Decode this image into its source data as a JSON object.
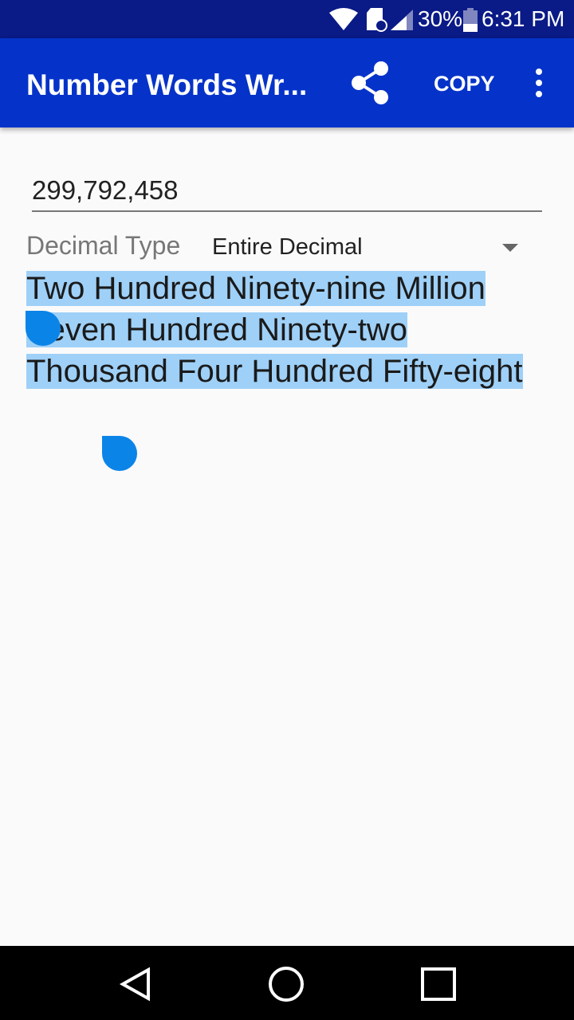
{
  "status_bar": {
    "battery": "30%",
    "time": "6:31 PM",
    "icons": [
      "wifi-icon",
      "sd-card-error-icon",
      "signal-icon",
      "battery-icon"
    ]
  },
  "app_bar": {
    "title": "Number Words Wr...",
    "share_icon": "share-icon",
    "copy_label": "COPY",
    "menu_icon": "more-vert-icon"
  },
  "input": {
    "value": "299,792,458"
  },
  "decimal": {
    "label": "Decimal Type",
    "selected": "Entire Decimal"
  },
  "result": {
    "text": "Two Hundred Ninety-nine Million Seven Hundred Ninety-two Thousand Four Hundred Fifty-eight"
  },
  "colors": {
    "status_bar": "#0a1a86",
    "app_bar": "#0533c9",
    "selection": "#9fd0f7",
    "handle": "#0b84e8"
  }
}
